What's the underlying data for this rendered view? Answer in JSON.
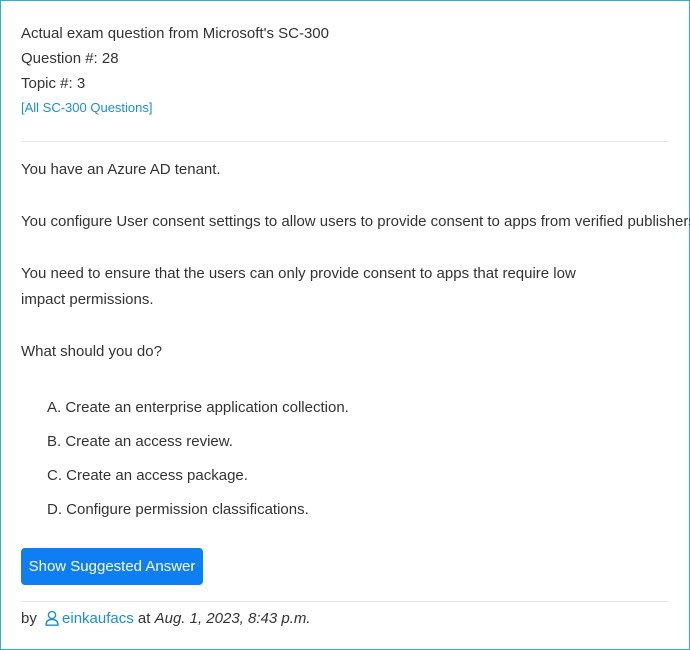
{
  "header": {
    "title": "Actual exam question from Microsoft's SC-300",
    "question_number": "Question #: 28",
    "topic": "Topic #: 3",
    "all_questions_link": "[All SC-300 Questions]"
  },
  "question": {
    "paragraphs": [
      "You have an Azure AD tenant.",
      "You configure User consent settings to allow users to provide consent to apps from verified publishers.",
      "You need to ensure that the users can only provide consent to apps that require low impact permissions.",
      "What should you do?"
    ],
    "choices": [
      "A. Create an enterprise application collection.",
      "B. Create an access review.",
      "C. Create an access package.",
      "D. Configure permission classifications."
    ]
  },
  "actions": {
    "show_answer_label": "Show Suggested Answer"
  },
  "footer": {
    "by_label": "by",
    "username": "einkaufacs",
    "at_label": "at",
    "date": "Aug. 1, 2023, 8:43 p.m."
  },
  "colors": {
    "accent": "#0d7ff3",
    "link": "#1b8fd2",
    "border": "#35a9e0"
  },
  "icons": {
    "user": "user-icon"
  }
}
